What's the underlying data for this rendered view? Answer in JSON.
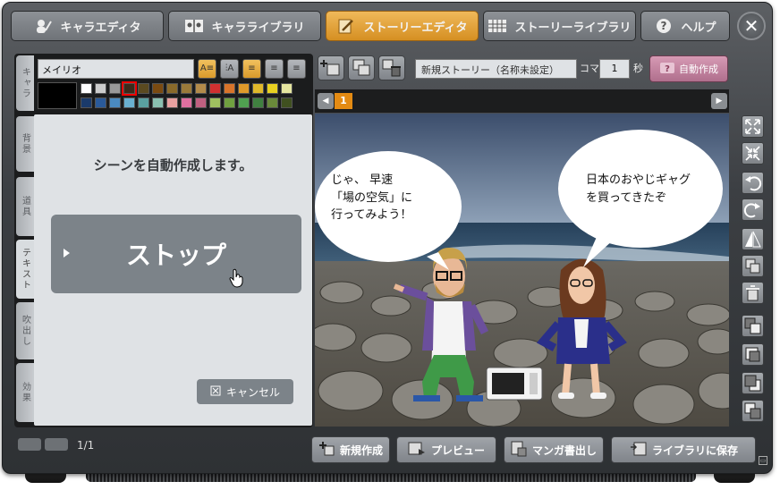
{
  "tabs": [
    {
      "label": "キャラエディタ",
      "icon": "character-pen-icon"
    },
    {
      "label": "キャラライブラリ",
      "icon": "book-icon"
    },
    {
      "label": "ストーリーエディタ",
      "icon": "pencil-paper-icon",
      "active": true
    },
    {
      "label": "ストーリーライブラリ",
      "icon": "grid-book-icon"
    },
    {
      "label": "ヘルプ",
      "icon": "question-icon"
    }
  ],
  "close_label": "✕",
  "side_tabs": [
    "キャラ",
    "背景",
    "道具",
    "テキスト",
    "吹出し",
    "効果"
  ],
  "font_select": "メイリオ",
  "colors": {
    "accent": "#e48b13",
    "active_tab": "#d58f22",
    "auto_button": "#c282a0",
    "panel": "#dfe2e5",
    "button_gray": "#7c8389"
  },
  "palette_row1": [
    "#ffffff",
    "#cccccc",
    "#999999",
    "#3a2a1a",
    "#5b4a20",
    "#7a4a10",
    "#8a6a2a",
    "#9a7a3a",
    "#b38b4a",
    "#d03030",
    "#d8742a",
    "#e09a2a",
    "#e0b82a",
    "#e8d020",
    "#e6e6a0"
  ],
  "palette_row2": [
    "#1a3a6a",
    "#2a5a9a",
    "#4a8ac0",
    "#6ab0d0",
    "#5aa0a0",
    "#8ac0b0",
    "#e8a0a0",
    "#e070a0",
    "#c06080",
    "#a0c060",
    "#70a040",
    "#50a050",
    "#408040",
    "#6a8a3a",
    "#405020"
  ],
  "panel_heading": "シーンを自動作成します。",
  "stop_label": "ストップ",
  "cancel_label": "キャンセル",
  "story_title_placeholder": "新規ストーリー（名称未設定）",
  "koma_label": "コマ",
  "koma_value": "1",
  "byo_label": "秒",
  "auto_create_label": "自動作成",
  "frame_number": "1",
  "bubble_left": "じゃ、 早速\n「場の空気」に\n行ってみよう！",
  "bubble_right": "日本のおやじギャグ\nを買ってきたぞ",
  "pager_text": "1/1",
  "bottom_buttons": {
    "new": "新規作成",
    "preview": "プレビュー",
    "manga_export": "マンガ書出し",
    "save_library": "ライブラリに保存"
  }
}
